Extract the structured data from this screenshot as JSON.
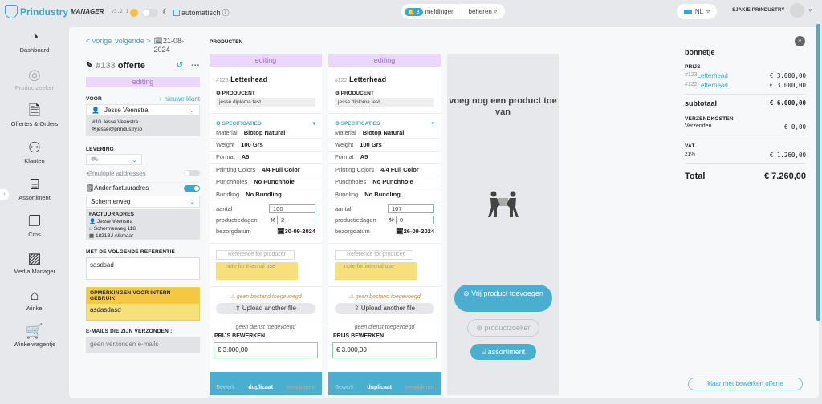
{
  "app": {
    "name": "Prindustry",
    "suffix": "MANAGER",
    "version": "v3.2.1"
  },
  "theme": {
    "auto_label": "automatisch"
  },
  "header": {
    "notif_count": "3",
    "notif_label": "meldingen",
    "manage_label": "beheren",
    "language": "NL",
    "user_name": "SJAKIE PRINDUSTRY"
  },
  "sidebar": {
    "items": [
      {
        "label": "Dashboard",
        "icon": "dashboard-icon"
      },
      {
        "label": "Productzoeker",
        "icon": "target-icon"
      },
      {
        "label": "Offertes & Orders",
        "icon": "invoice-icon"
      },
      {
        "label": "Klanten",
        "icon": "users-icon"
      },
      {
        "label": "Assortiment",
        "icon": "box-icon"
      },
      {
        "label": "Cms",
        "icon": "cms-icon"
      },
      {
        "label": "Media Manager",
        "icon": "media-icon"
      },
      {
        "label": "Winkel",
        "icon": "shop-icon"
      },
      {
        "label": "Winkelwagentje",
        "icon": "cart-icon"
      }
    ]
  },
  "quote": {
    "prev": "< vorige",
    "next": "volgende >",
    "date": "21-08-2024",
    "number": "#133",
    "type": "offerte",
    "status": "editing",
    "voor_label": "VOOR",
    "new_client": "+ nieuwe klant",
    "client": "Jesse Veenstra",
    "client_id": "#10 Jesse Veenstra",
    "client_email": "jesse@prindustry.io",
    "levering_label": "LEVERING",
    "multiple_label": "multiple addresses",
    "ander_label": "Ander factuuradres",
    "address_select": "Schermerweg",
    "factuur_label": "FACTUURADRES",
    "factuur_lines": [
      "Jesse Veenstra",
      "Schermerweg 118",
      "1821BJ Alkmaar"
    ],
    "ref_label": "MET DE VOLGENDE REFERENTIE",
    "ref_value": "sasdsad",
    "intern_label": "OPMERKINGEN VOOR INTERN GEBRUIK",
    "intern_value": "asdasdasd",
    "emails_label": "E-MAILS DIE ZIJN VERZONDEN :",
    "emails_value": "geen verzonden e-mails"
  },
  "products_label": "PRODUCTEN",
  "products": [
    {
      "status": "editing",
      "id": "#123",
      "name": "Letterhead",
      "producent_label": "PRODUCENT",
      "producent": "jesse.diploma.test",
      "spec_label": "SPECIFICATIES",
      "specs": [
        [
          "Material",
          "Biotop Natural"
        ],
        [
          "Weight",
          "100 Grs"
        ],
        [
          "Format",
          "A5"
        ],
        [
          "Printing Colors",
          "4/4 Full Color"
        ],
        [
          "Punchholes",
          "No Punchhole"
        ],
        [
          "Bundling",
          "No Bundling"
        ]
      ],
      "aantal_label": "aantal",
      "aantal": "100",
      "dagen_label": "productiedagen",
      "dagen": "2",
      "datum_label": "bezorgdatum",
      "datum": "30-09-2024",
      "ref_placeholder": "Reference for producer",
      "note_placeholder": "note for internal use",
      "file_warning": "geen bestand toegevoegd",
      "upload": "Upload another file",
      "dienst": "geen dienst toegevoegd",
      "prijs_label": "PRIJS BEWERKEN",
      "prijs": "€ 3.000,00",
      "actions": [
        "Bewerk",
        "duplicaat",
        "verwijderen"
      ]
    },
    {
      "status": "editing",
      "id": "#122",
      "name": "Letterhead",
      "producent_label": "PRODUCENT",
      "producent": "jesse.diploma.test",
      "spec_label": "SPECIFICATIES",
      "specs": [
        [
          "Material",
          "Biotop Natural"
        ],
        [
          "Weight",
          "100 Grs"
        ],
        [
          "Format",
          "A5"
        ],
        [
          "Printing Colors",
          "4/4 Full Color"
        ],
        [
          "Punchholes",
          "No Punchhole"
        ],
        [
          "Bundling",
          "No Bundling"
        ]
      ],
      "aantal_label": "aantal",
      "aantal": "107",
      "dagen_label": "productiedagen",
      "dagen": "0",
      "datum_label": "bezorgdatum",
      "datum": "26-09-2024",
      "ref_placeholder": "Reference for producer",
      "note_placeholder": "note for internal use",
      "file_warning": "geen bestand toegevoegd",
      "upload": "Upload another file",
      "dienst": "geen dienst toegevoegd",
      "prijs_label": "PRIJS BEWERKEN",
      "prijs": "€ 3.000,00",
      "actions": [
        "Bewerk",
        "duplicaat",
        "verwijderen"
      ]
    }
  ],
  "add": {
    "title": "voeg nog een product toe van",
    "vrij": "Vrij product toevoegen",
    "productzoeker": "productzoeker",
    "assortiment": "assortiment"
  },
  "receipt": {
    "title": "bonnetje",
    "prijs_label": "PRIJS",
    "lines": [
      {
        "id": "#123",
        "name": "Letterhead",
        "value": "€ 3.000,00"
      },
      {
        "id": "#122",
        "name": "Letterhead",
        "value": "€ 3.000,00"
      }
    ],
    "subtotal_label": "subtotaal",
    "subtotal": "€ 6.000,00",
    "shipping_label": "VERZENDKOSTEN",
    "shipping_name": "Verzenden",
    "shipping": "€ 0,00",
    "vat_label": "VAT",
    "vat_rate": "21%",
    "vat": "€ 1.260,00",
    "total_label": "Total",
    "total": "€ 7.260,00",
    "done": "klaar met bewerken offerte"
  },
  "colors": {
    "accent": "#3aa7cc",
    "editing_bg": "#ead7fb",
    "note_bg": "#f6e079"
  }
}
